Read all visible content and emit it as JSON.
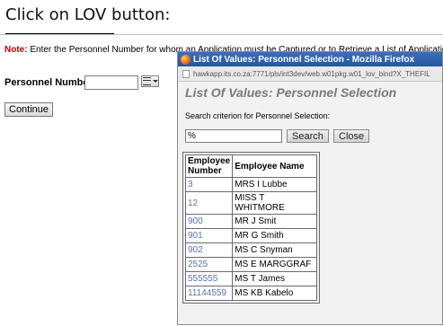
{
  "caption": "Click on LOV button:",
  "background_form": {
    "note_prefix": "Note:",
    "note_text": "Enter the Personnel Number for whom an Application must be Captured or to Retrieve a List of Application",
    "personnel_label": "Personnel Number:",
    "personnel_value": "",
    "continue_label": "Continue"
  },
  "popup": {
    "window_title": "List Of Values: Personnel Selection - Mozilla Firefox",
    "url": "hawkapp.its.co.za:7771/pls/int3dev/web.w01pkg.w01_lov_bind?X_THEFIL",
    "heading": "List Of Values: Personnel Selection",
    "criterion_label": "Search criterion for Personnel Selection:",
    "search_value": "%",
    "search_label": "Search",
    "close_label": "Close",
    "table": {
      "headers": [
        "Employee Number",
        "Employee Name"
      ],
      "rows": [
        [
          "3",
          "MRS I Lubbe"
        ],
        [
          "12",
          "MISS T WHITMORE"
        ],
        [
          "900",
          "MR J Smit"
        ],
        [
          "901",
          "MR G Smith"
        ],
        [
          "902",
          "MS C Snyman"
        ],
        [
          "2525",
          "MS E MARGGRAF"
        ],
        [
          "555555",
          "MS T James"
        ],
        [
          "11144559",
          "MS KB Kabelo"
        ]
      ]
    }
  },
  "colors": {
    "titlebar": "#2457a3",
    "note_prefix": "#c00000",
    "employee_number_link": "#5a74a8",
    "heading_gray": "#7a7a7a"
  },
  "icons": [
    "firefox-icon",
    "page-icon",
    "list-icon",
    "dropdown-arrow-icon"
  ]
}
